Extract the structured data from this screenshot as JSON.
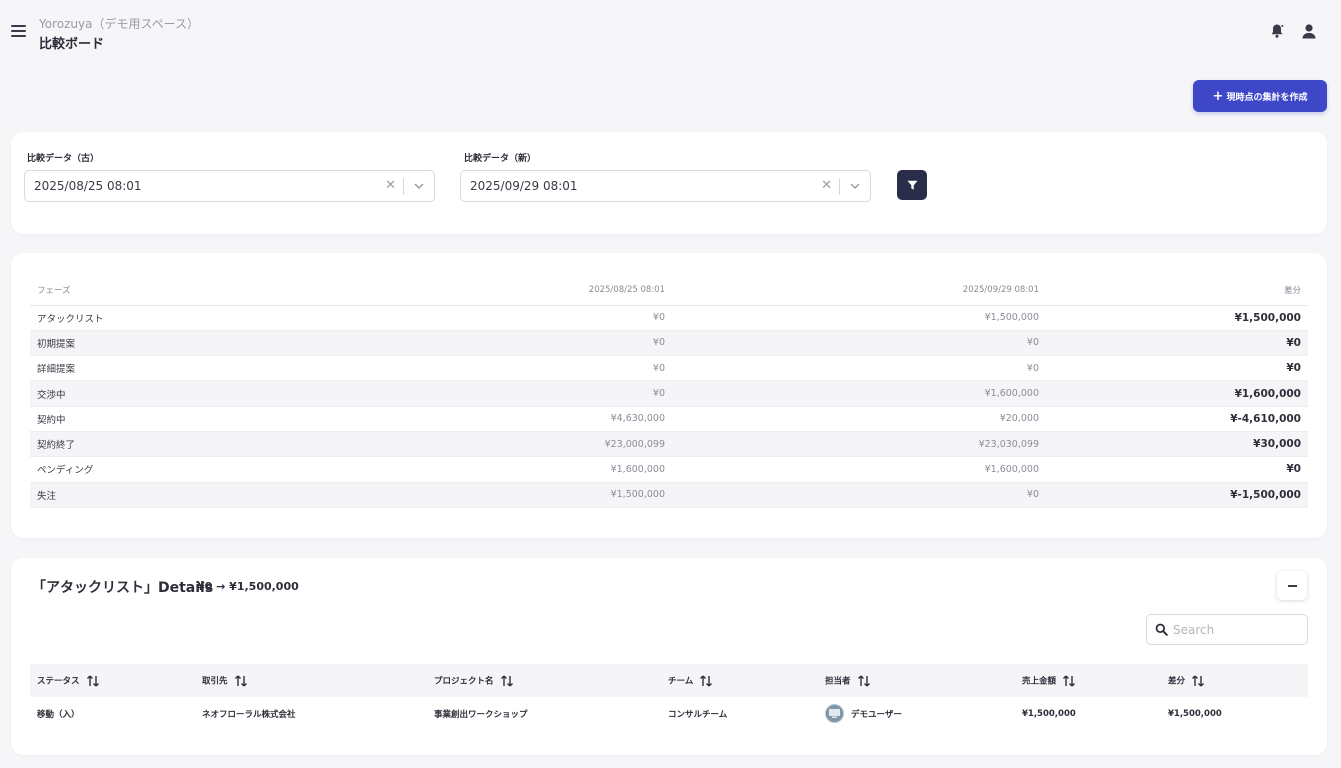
{
  "header": {
    "workspace": "Yorozuya（デモ用スペース）",
    "title": "比較ボード"
  },
  "actions": {
    "create_label": "現時点の集計を作成"
  },
  "filters": {
    "old_label": "比較データ（古）",
    "old_value": "2025/08/25 08:01",
    "new_label": "比較データ（新）",
    "new_value": "2025/09/29 08:01"
  },
  "summary": {
    "headers": [
      "フェーズ",
      "2025/08/25 08:01",
      "2025/09/29 08:01",
      "差分"
    ],
    "rows": [
      {
        "phase": "アタックリスト",
        "old": "¥0",
        "new": "¥1,500,000",
        "diff": "¥1,500,000"
      },
      {
        "phase": "初期提案",
        "old": "¥0",
        "new": "¥0",
        "diff": "¥0"
      },
      {
        "phase": "詳細提案",
        "old": "¥0",
        "new": "¥0",
        "diff": "¥0"
      },
      {
        "phase": "交渉中",
        "old": "¥0",
        "new": "¥1,600,000",
        "diff": "¥1,600,000"
      },
      {
        "phase": "契約中",
        "old": "¥4,630,000",
        "new": "¥20,000",
        "diff": "¥-4,610,000"
      },
      {
        "phase": "契約終了",
        "old": "¥23,000,099",
        "new": "¥23,030,099",
        "diff": "¥30,000"
      },
      {
        "phase": "ペンディング",
        "old": "¥1,600,000",
        "new": "¥1,600,000",
        "diff": "¥0"
      },
      {
        "phase": "失注",
        "old": "¥1,500,000",
        "new": "¥0",
        "diff": "¥-1,500,000"
      }
    ]
  },
  "details": {
    "title": "「アタックリスト」Details",
    "range": "¥0 → ¥1,500,000",
    "search_placeholder": "Search",
    "headers": [
      "ステータス",
      "取引先",
      "プロジェクト名",
      "チーム",
      "担当者",
      "売上金額",
      "差分"
    ],
    "rows": [
      {
        "status": "移動（入）",
        "client": "ネオフローラル株式会社",
        "project": "事業創出ワークショップ",
        "team": "コンサルチーム",
        "owner": "デモユーザー",
        "amount": "¥1,500,000",
        "diff": "¥1,500,000"
      }
    ]
  },
  "colors": {
    "primary": "#3f47c9",
    "dark_button": "#2a2d4a",
    "background": "#f6f6f9"
  },
  "icons": [
    "menu-icon",
    "bell-icon",
    "user-icon",
    "plus-icon",
    "clear-icon",
    "chevron-down-icon",
    "filter-icon",
    "minus-icon",
    "search-icon",
    "sort-icon"
  ]
}
